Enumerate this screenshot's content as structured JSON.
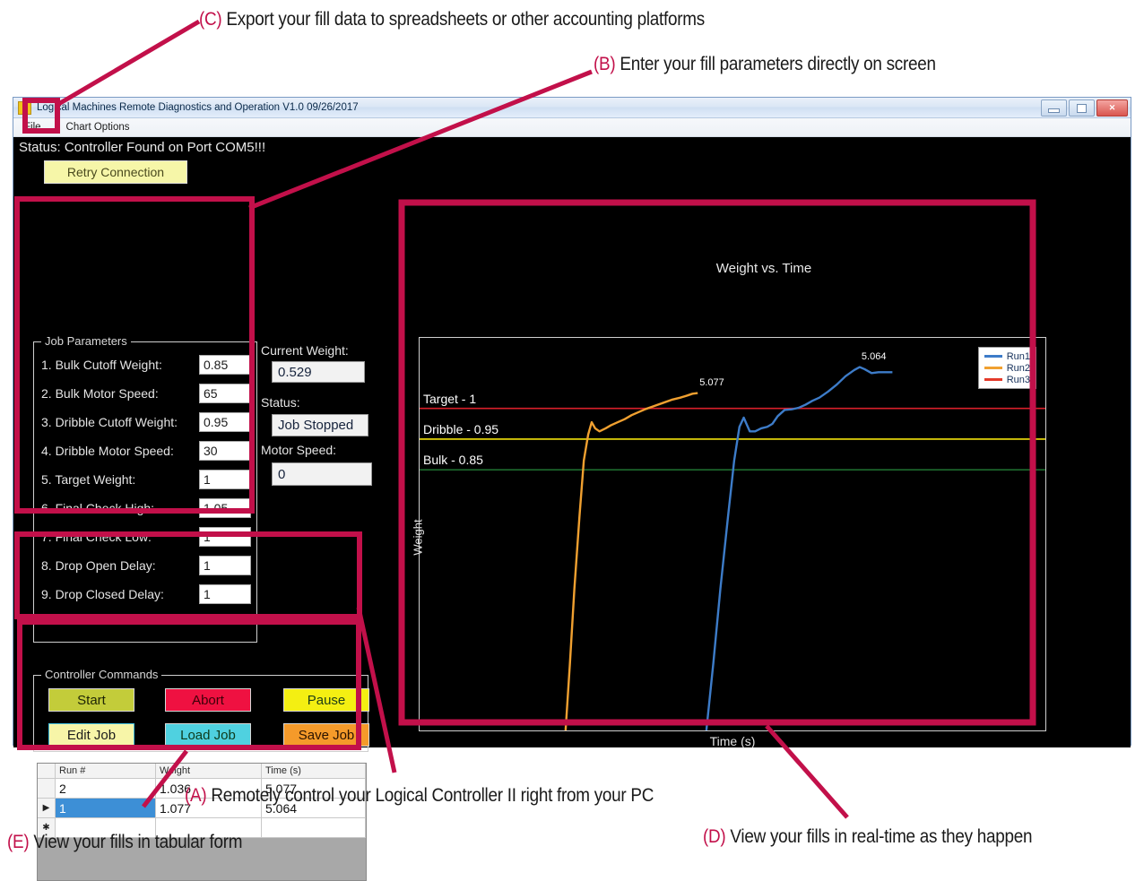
{
  "annotations": [
    {
      "id": "C",
      "tag": "(C)",
      "text": "Export your fill data to spreadsheets or other accounting platforms"
    },
    {
      "id": "B",
      "tag": "(B)",
      "text": "Enter your fill parameters directly on screen"
    },
    {
      "id": "A",
      "tag": "(A)",
      "text": "Remotely control your Logical Controller II right from your PC"
    },
    {
      "id": "E",
      "tag": "(E)",
      "text": "View your fills in tabular form"
    },
    {
      "id": "D",
      "tag": "(D)",
      "text": "View your fills in real-time as they happen"
    }
  ],
  "annotation_color": "#C2104A",
  "window": {
    "title": "Logical Machines Remote Diagnostics and Operation V1.0 09/26/2017",
    "menu": [
      "File",
      "Chart Options"
    ],
    "buttons": {
      "minimize": "minimize-button",
      "maximize": "maximize-button",
      "close": "✕"
    }
  },
  "status": {
    "text": "Status: Controller Found on Port COM5!!!",
    "retry_label": "Retry Connection"
  },
  "job_parameters": {
    "legend": "Job Parameters",
    "rows": [
      {
        "label": "1. Bulk Cutoff Weight:",
        "value": "0.85"
      },
      {
        "label": "2. Bulk Motor Speed:",
        "value": "65"
      },
      {
        "label": "3. Dribble Cutoff Weight:",
        "value": "0.95"
      },
      {
        "label": "4. Dribble Motor Speed:",
        "value": "30"
      },
      {
        "label": "5. Target Weight:",
        "value": "1"
      },
      {
        "label": "6. Final Check High:",
        "value": "1.05"
      },
      {
        "label": "7. Final Check Low:",
        "value": "1"
      },
      {
        "label": "8. Drop Open Delay:",
        "value": "1"
      },
      {
        "label": "9. Drop Closed Delay:",
        "value": "1"
      }
    ]
  },
  "readouts": {
    "current_weight_label": "Current Weight:",
    "current_weight_value": "0.529",
    "status_label": "Status:",
    "status_value": "Job Stopped",
    "motor_speed_label": "Motor Speed:",
    "motor_speed_value": "0"
  },
  "controller_commands": {
    "legend": "Controller Commands",
    "buttons": [
      {
        "label": "Start",
        "bg": "#c3cc3a",
        "fg": "#1d2405"
      },
      {
        "label": "Abort",
        "bg": "#ef1141",
        "fg": "#3d0008"
      },
      {
        "label": "Pause",
        "bg": "#f4ef12",
        "fg": "#1d3d16"
      },
      {
        "label": "Edit Job",
        "bg": "#f7f5a8",
        "fg": "#1b1b1b",
        "border": "#41bede"
      },
      {
        "label": "Load Job",
        "bg": "#4fd1e0",
        "fg": "#0d3a1b"
      },
      {
        "label": "Save Job",
        "bg": "#f59a2a",
        "fg": "#2a1200"
      }
    ]
  },
  "grid": {
    "columns": [
      "Run #",
      "Weight",
      "Time (s)"
    ],
    "rows": [
      {
        "run": "2",
        "weight": "1.036",
        "time": "5.077",
        "marker": "",
        "selected": false
      },
      {
        "run": "1",
        "weight": "1.077",
        "time": "5.064",
        "marker": "▶",
        "selected": true
      },
      {
        "run": "",
        "weight": "",
        "time": "",
        "marker": "✱",
        "selected": false
      }
    ]
  },
  "chart_data": {
    "type": "line",
    "title": "Weight vs. Time",
    "xlabel": "Time (s)",
    "ylabel": "Weight",
    "xlim": [
      0,
      7.2
    ],
    "ylim": [
      0,
      1.28
    ],
    "grid": false,
    "legend_position": "top-right",
    "series": [
      {
        "name": "Run1",
        "color": "#3d7cc9",
        "end_label": "5.064",
        "points": [
          [
            3.3,
            0.0
          ],
          [
            3.38,
            0.22
          ],
          [
            3.46,
            0.46
          ],
          [
            3.55,
            0.7
          ],
          [
            3.62,
            0.88
          ],
          [
            3.68,
            0.99
          ],
          [
            3.73,
            1.02
          ],
          [
            3.76,
            1.0
          ],
          [
            3.8,
            0.975
          ],
          [
            3.86,
            0.975
          ],
          [
            3.93,
            0.985
          ],
          [
            4.0,
            0.99
          ],
          [
            4.06,
            1.0
          ],
          [
            4.12,
            1.025
          ],
          [
            4.2,
            1.045
          ],
          [
            4.28,
            1.047
          ],
          [
            4.36,
            1.052
          ],
          [
            4.44,
            1.062
          ],
          [
            4.52,
            1.075
          ],
          [
            4.6,
            1.085
          ],
          [
            4.7,
            1.105
          ],
          [
            4.8,
            1.128
          ],
          [
            4.9,
            1.155
          ],
          [
            5.0,
            1.175
          ],
          [
            5.064,
            1.185
          ],
          [
            5.12,
            1.178
          ],
          [
            5.2,
            1.165
          ],
          [
            5.28,
            1.168
          ],
          [
            5.36,
            1.168
          ],
          [
            5.44,
            1.168
          ]
        ]
      },
      {
        "name": "Run2",
        "color": "#f0a030",
        "end_label": "5.077",
        "points": [
          [
            1.68,
            0.0
          ],
          [
            1.73,
            0.22
          ],
          [
            1.78,
            0.46
          ],
          [
            1.84,
            0.7
          ],
          [
            1.89,
            0.88
          ],
          [
            1.94,
            0.965
          ],
          [
            1.98,
            1.005
          ],
          [
            2.02,
            0.985
          ],
          [
            2.07,
            0.975
          ],
          [
            2.14,
            0.985
          ],
          [
            2.2,
            0.995
          ],
          [
            2.28,
            1.005
          ],
          [
            2.36,
            1.015
          ],
          [
            2.44,
            1.028
          ],
          [
            2.52,
            1.038
          ],
          [
            2.6,
            1.048
          ],
          [
            2.7,
            1.058
          ],
          [
            2.8,
            1.068
          ],
          [
            2.9,
            1.078
          ],
          [
            3.0,
            1.085
          ],
          [
            3.08,
            1.092
          ],
          [
            3.14,
            1.098
          ],
          [
            3.2,
            1.1
          ]
        ]
      },
      {
        "name": "Run3",
        "color": "#e43a2a",
        "end_label": "",
        "points": []
      }
    ],
    "reference_lines": [
      {
        "label": "Target - 1",
        "value": 1.05,
        "color": "#d81f2a"
      },
      {
        "label": "Dribble - 0.95",
        "value": 0.95,
        "color": "#f2e30c"
      },
      {
        "label": "Bulk - 0.85",
        "value": 0.85,
        "color": "#1d6b2e"
      }
    ]
  }
}
